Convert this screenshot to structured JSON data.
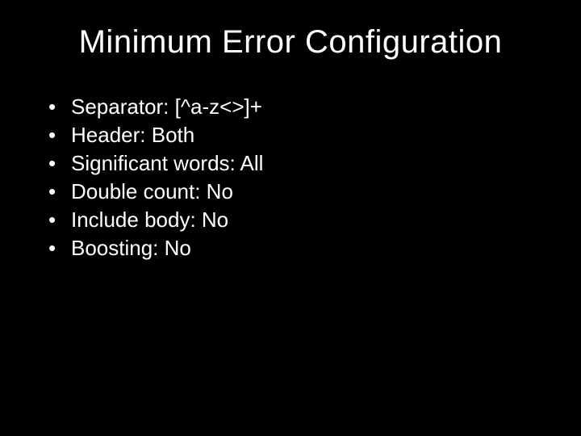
{
  "title": "Minimum Error Configuration",
  "bullets": [
    "Separator: [^a-z<>]+",
    "Header: Both",
    "Significant words: All",
    "Double count: No",
    "Include body: No",
    "Boosting: No"
  ]
}
